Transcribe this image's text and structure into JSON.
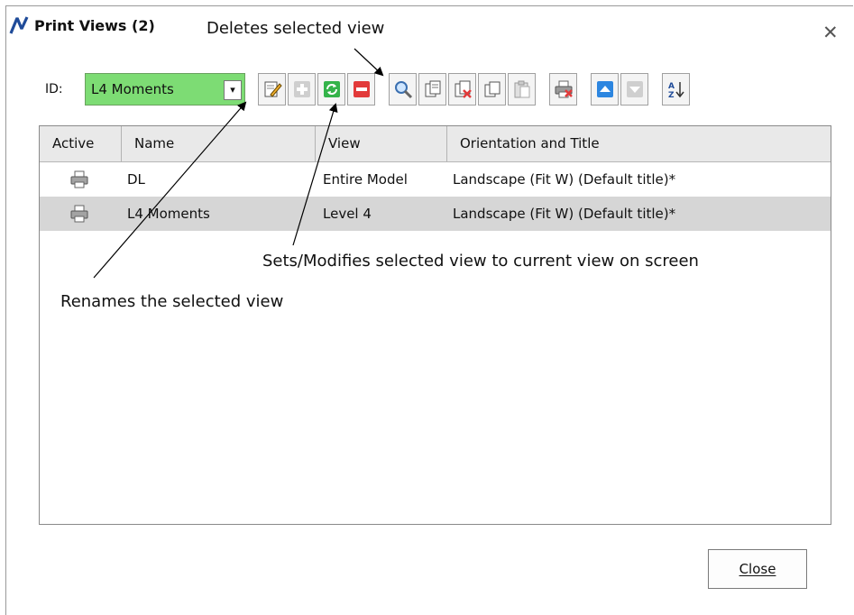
{
  "window": {
    "title": "Print Views (2)",
    "close_glyph": "✕"
  },
  "toolbar": {
    "id_label": "ID:",
    "id_value": "L4 Moments",
    "combo_arrow": "▾",
    "buttons": [
      {
        "name": "rename-icon"
      },
      {
        "name": "add-view-icon"
      },
      {
        "name": "set-view-icon"
      },
      {
        "name": "delete-view-icon"
      },
      {
        "name": "zoom-view-icon"
      },
      {
        "name": "copy-icon"
      },
      {
        "name": "copy-delete-icon"
      },
      {
        "name": "duplicate-icon"
      },
      {
        "name": "paste-icon"
      },
      {
        "name": "print-delete-icon"
      },
      {
        "name": "move-up-icon"
      },
      {
        "name": "move-down-icon"
      },
      {
        "name": "sort-az-icon"
      }
    ]
  },
  "table": {
    "columns": [
      "Active",
      "Name",
      "View",
      "Orientation and Title"
    ],
    "rows": [
      {
        "active_icon": "printer-icon",
        "name": "DL",
        "view": "Entire Model",
        "orientation": "Landscape (Fit W) (Default title)*",
        "selected": false
      },
      {
        "active_icon": "printer-icon",
        "name": "L4 Moments",
        "view": "Level 4",
        "orientation": "Landscape (Fit W) (Default title)*",
        "selected": true
      }
    ]
  },
  "annotations": {
    "delete": "Deletes selected view",
    "set": "Sets/Modifies selected view to current view on screen",
    "rename": "Renames the selected view"
  },
  "footer": {
    "close_label": "Close"
  },
  "colors": {
    "id_field_bg": "#7ddc74",
    "selected_row_bg": "#d6d6d6",
    "delete_red": "#e23a3a",
    "set_green": "#34b34a",
    "move_blue": "#2d86e0"
  }
}
